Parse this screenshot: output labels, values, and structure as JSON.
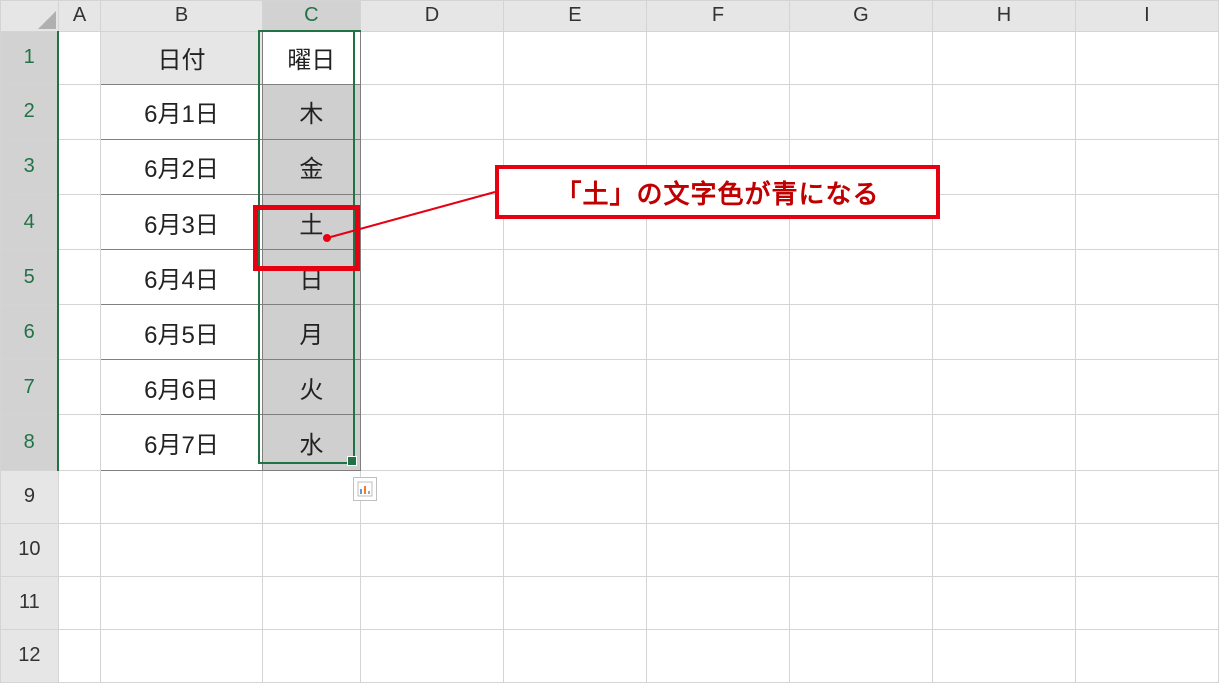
{
  "columns": [
    "A",
    "B",
    "C",
    "D",
    "E",
    "F",
    "G",
    "H",
    "I"
  ],
  "rows": [
    "1",
    "2",
    "3",
    "4",
    "5",
    "6",
    "7",
    "8",
    "9",
    "10",
    "11",
    "12"
  ],
  "table": {
    "header": {
      "date": "日付",
      "weekday": "曜日"
    },
    "rows": [
      {
        "date": "6月1日",
        "weekday": "木"
      },
      {
        "date": "6月2日",
        "weekday": "金"
      },
      {
        "date": "6月3日",
        "weekday": "土"
      },
      {
        "date": "6月4日",
        "weekday": "日"
      },
      {
        "date": "6月5日",
        "weekday": "月"
      },
      {
        "date": "6月6日",
        "weekday": "火"
      },
      {
        "date": "6月7日",
        "weekday": "水"
      }
    ]
  },
  "callout": {
    "text": "「土」の文字色が青になる"
  },
  "icons": {
    "pasteOptions": "paste-options-icon",
    "selectAllCorner": "select-all-triangle"
  }
}
